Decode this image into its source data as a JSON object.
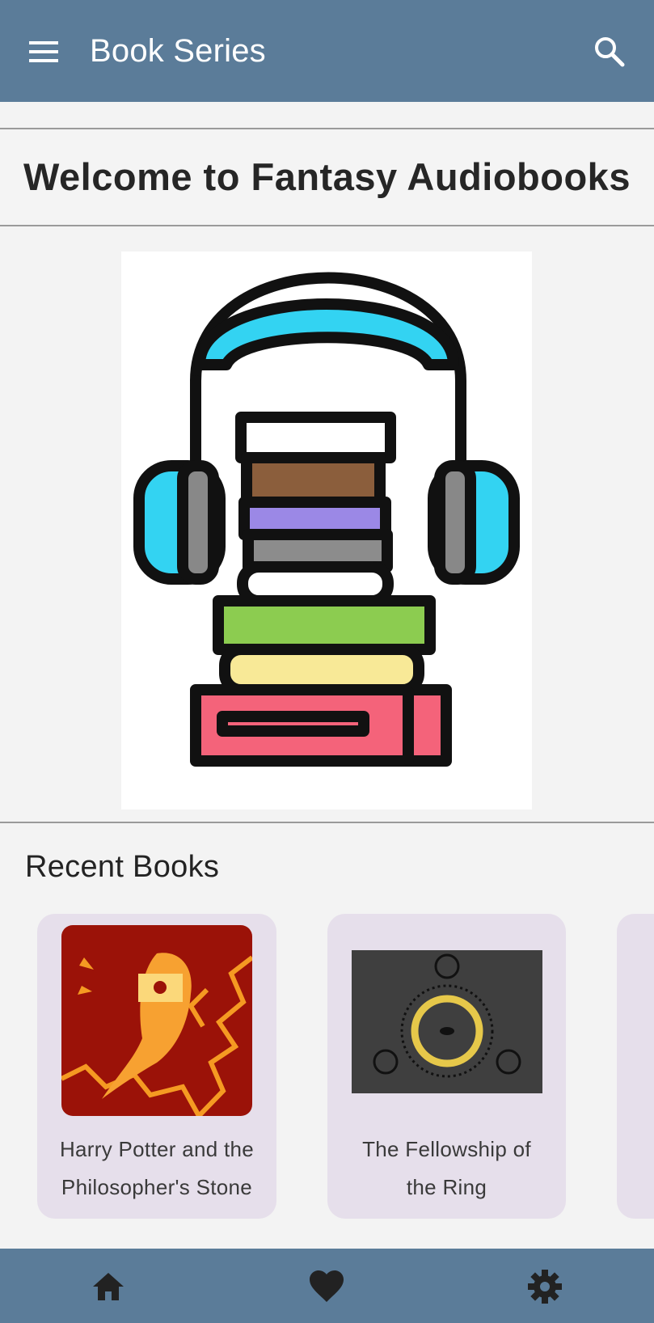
{
  "app_bar": {
    "title": "Book Series",
    "menu_icon": "menu-icon",
    "search_icon": "search-icon",
    "background": "#5b7c99"
  },
  "welcome": {
    "heading": "Welcome to Fantasy Audiobooks"
  },
  "hero": {
    "icon": "headphones-with-book-stack-illustration"
  },
  "recent": {
    "section_title": "Recent Books",
    "books": [
      {
        "title_line1": "Harry Potter and the",
        "title_line2": "Philosopher's Stone",
        "cover_icon": "owl-letter-cover"
      },
      {
        "title_line1": "The Fellowship of",
        "title_line2": "the Ring",
        "cover_icon": "one-ring-cover"
      }
    ]
  },
  "bottom_nav": {
    "items": [
      {
        "icon": "home-icon"
      },
      {
        "icon": "heart-icon"
      },
      {
        "icon": "gear-icon"
      }
    ]
  },
  "colors": {
    "accent": "#5b7c99",
    "card_background": "#e6dfeb",
    "page_background": "#f3f3f3"
  }
}
